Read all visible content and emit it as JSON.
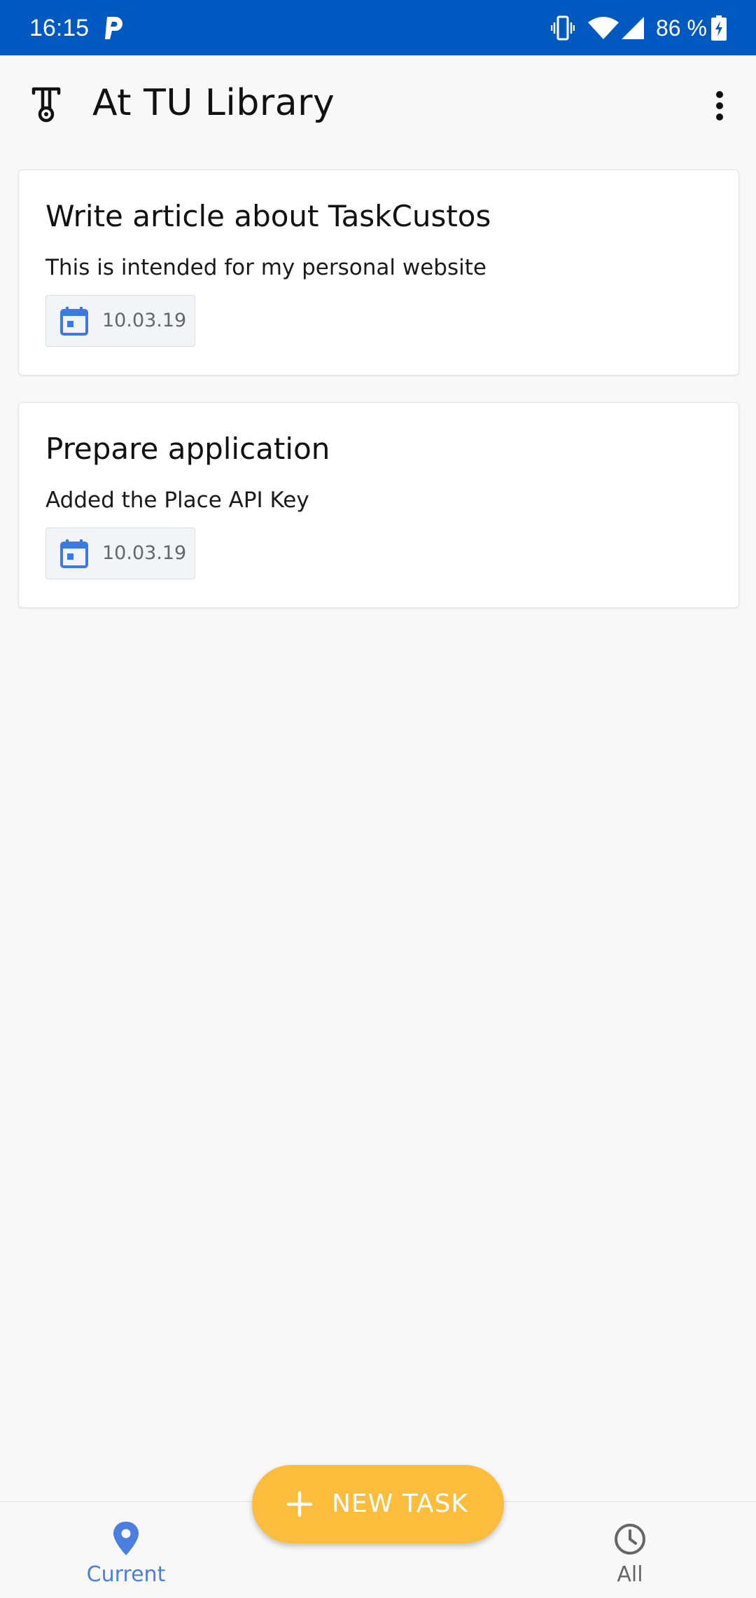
{
  "status_bar": {
    "time": "16:15",
    "battery_text": "86 %",
    "icons": [
      "parking-p-icon",
      "vibrate-icon",
      "wifi-icon",
      "cell-signal-icon",
      "battery-charging-icon"
    ]
  },
  "app_bar": {
    "title": "At TU Library",
    "logo_icon": "taskcustos-logo-icon",
    "overflow_icon": "more-vert-icon"
  },
  "tasks": [
    {
      "title": "Write article about TaskCustos",
      "description": "This is intended for my personal website",
      "date": "10.03.19",
      "date_icon": "calendar-icon"
    },
    {
      "title": "Prepare application",
      "description": "Added the Place API Key",
      "date": "10.03.19",
      "date_icon": "calendar-icon"
    }
  ],
  "fab": {
    "label": "NEW TASK",
    "icon": "plus-icon",
    "color": "#fdbd3c"
  },
  "bottom_nav": {
    "items": [
      {
        "label": "Current",
        "icon": "location-pin-icon",
        "active": true
      },
      {
        "label": "All",
        "icon": "clock-icon",
        "active": false
      }
    ],
    "active_color": "#4a7fe0"
  },
  "colors": {
    "status_bar": "#0059c1",
    "accent": "#4a7fe0",
    "background": "#f8f8f8"
  }
}
